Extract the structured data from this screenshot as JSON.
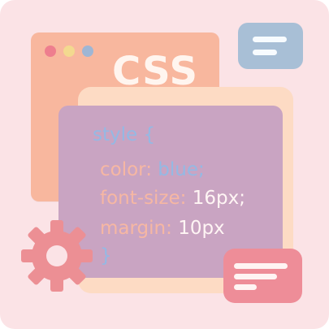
{
  "illustration": {
    "css_label": "CSS",
    "code": {
      "line1": "style {",
      "line2_property": "color:",
      "line2_value": "blue;",
      "line3_property": "font-size:",
      "line3_value": "16px;",
      "line4_property": "margin:",
      "line4_value": "10px",
      "line5": "}"
    },
    "icons": {
      "window_dots": [
        "red-dot-icon",
        "yellow-dot-icon",
        "blue-dot-icon"
      ],
      "top_right_icon": "chat-bubble-icon",
      "bottom_right_icon": "message-lines-icon",
      "bottom_left_icon": "gear-icon"
    },
    "colors": {
      "background": "#fbe3e6",
      "window": "#f8b79e",
      "code_panel": "#c9a4c2",
      "peach_panel": "#fddbc4",
      "keyword": "#94b9e4",
      "property": "#f6b7a3",
      "value": "#fff5f4",
      "gear": "#ec8f94"
    }
  }
}
